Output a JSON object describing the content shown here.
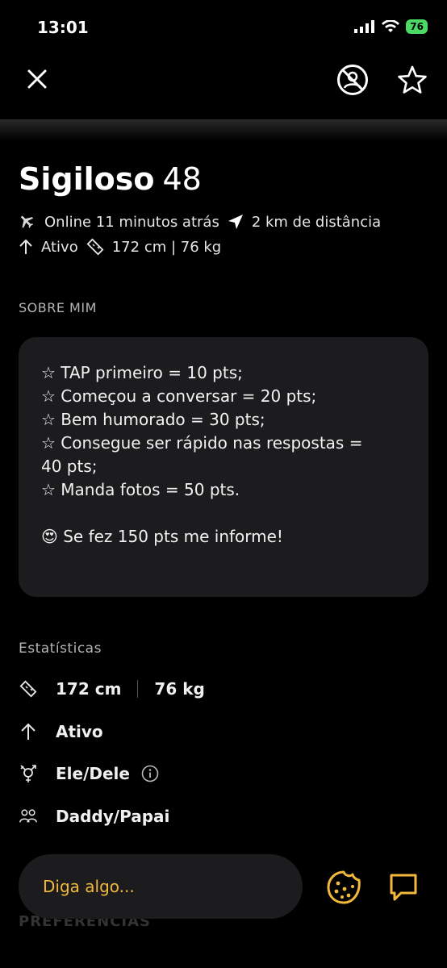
{
  "status_bar": {
    "time": "13:01",
    "battery": "76"
  },
  "header": {
    "close_icon": "close-icon",
    "incognito_icon": "profile-blocked-icon",
    "favorite_icon": "star-icon"
  },
  "profile": {
    "name": "Sigiloso",
    "age": "48",
    "online": "Online 11 minutos atrás",
    "distance": "2 km de distância",
    "position": "Ativo",
    "measures": "172 cm | 76 kg"
  },
  "about": {
    "title": "SOBRE MIM",
    "lines": [
      "☆ TAP primeiro = 10 pts;",
      "☆ Começou a conversar = 20 pts;",
      "☆ Bem humorado = 30 pts;",
      "☆ Consegue ser rápido nas respostas =",
      "40 pts;",
      "☆ Manda fotos = 50 pts.",
      "",
      "😍 Se fez 150 pts me informe!"
    ]
  },
  "stats": {
    "title": "Estatísticas",
    "height": "172 cm",
    "weight": "76 kg",
    "position": "Ativo",
    "pronouns": "Ele/Dele",
    "tribe": "Daddy/Papai"
  },
  "preferences": {
    "title": "PREFERÊNCIAS"
  },
  "composer": {
    "placeholder": "Diga algo..."
  },
  "colors": {
    "accent": "#f3b93d",
    "card": "#1c1c1e",
    "background": "#000000"
  }
}
